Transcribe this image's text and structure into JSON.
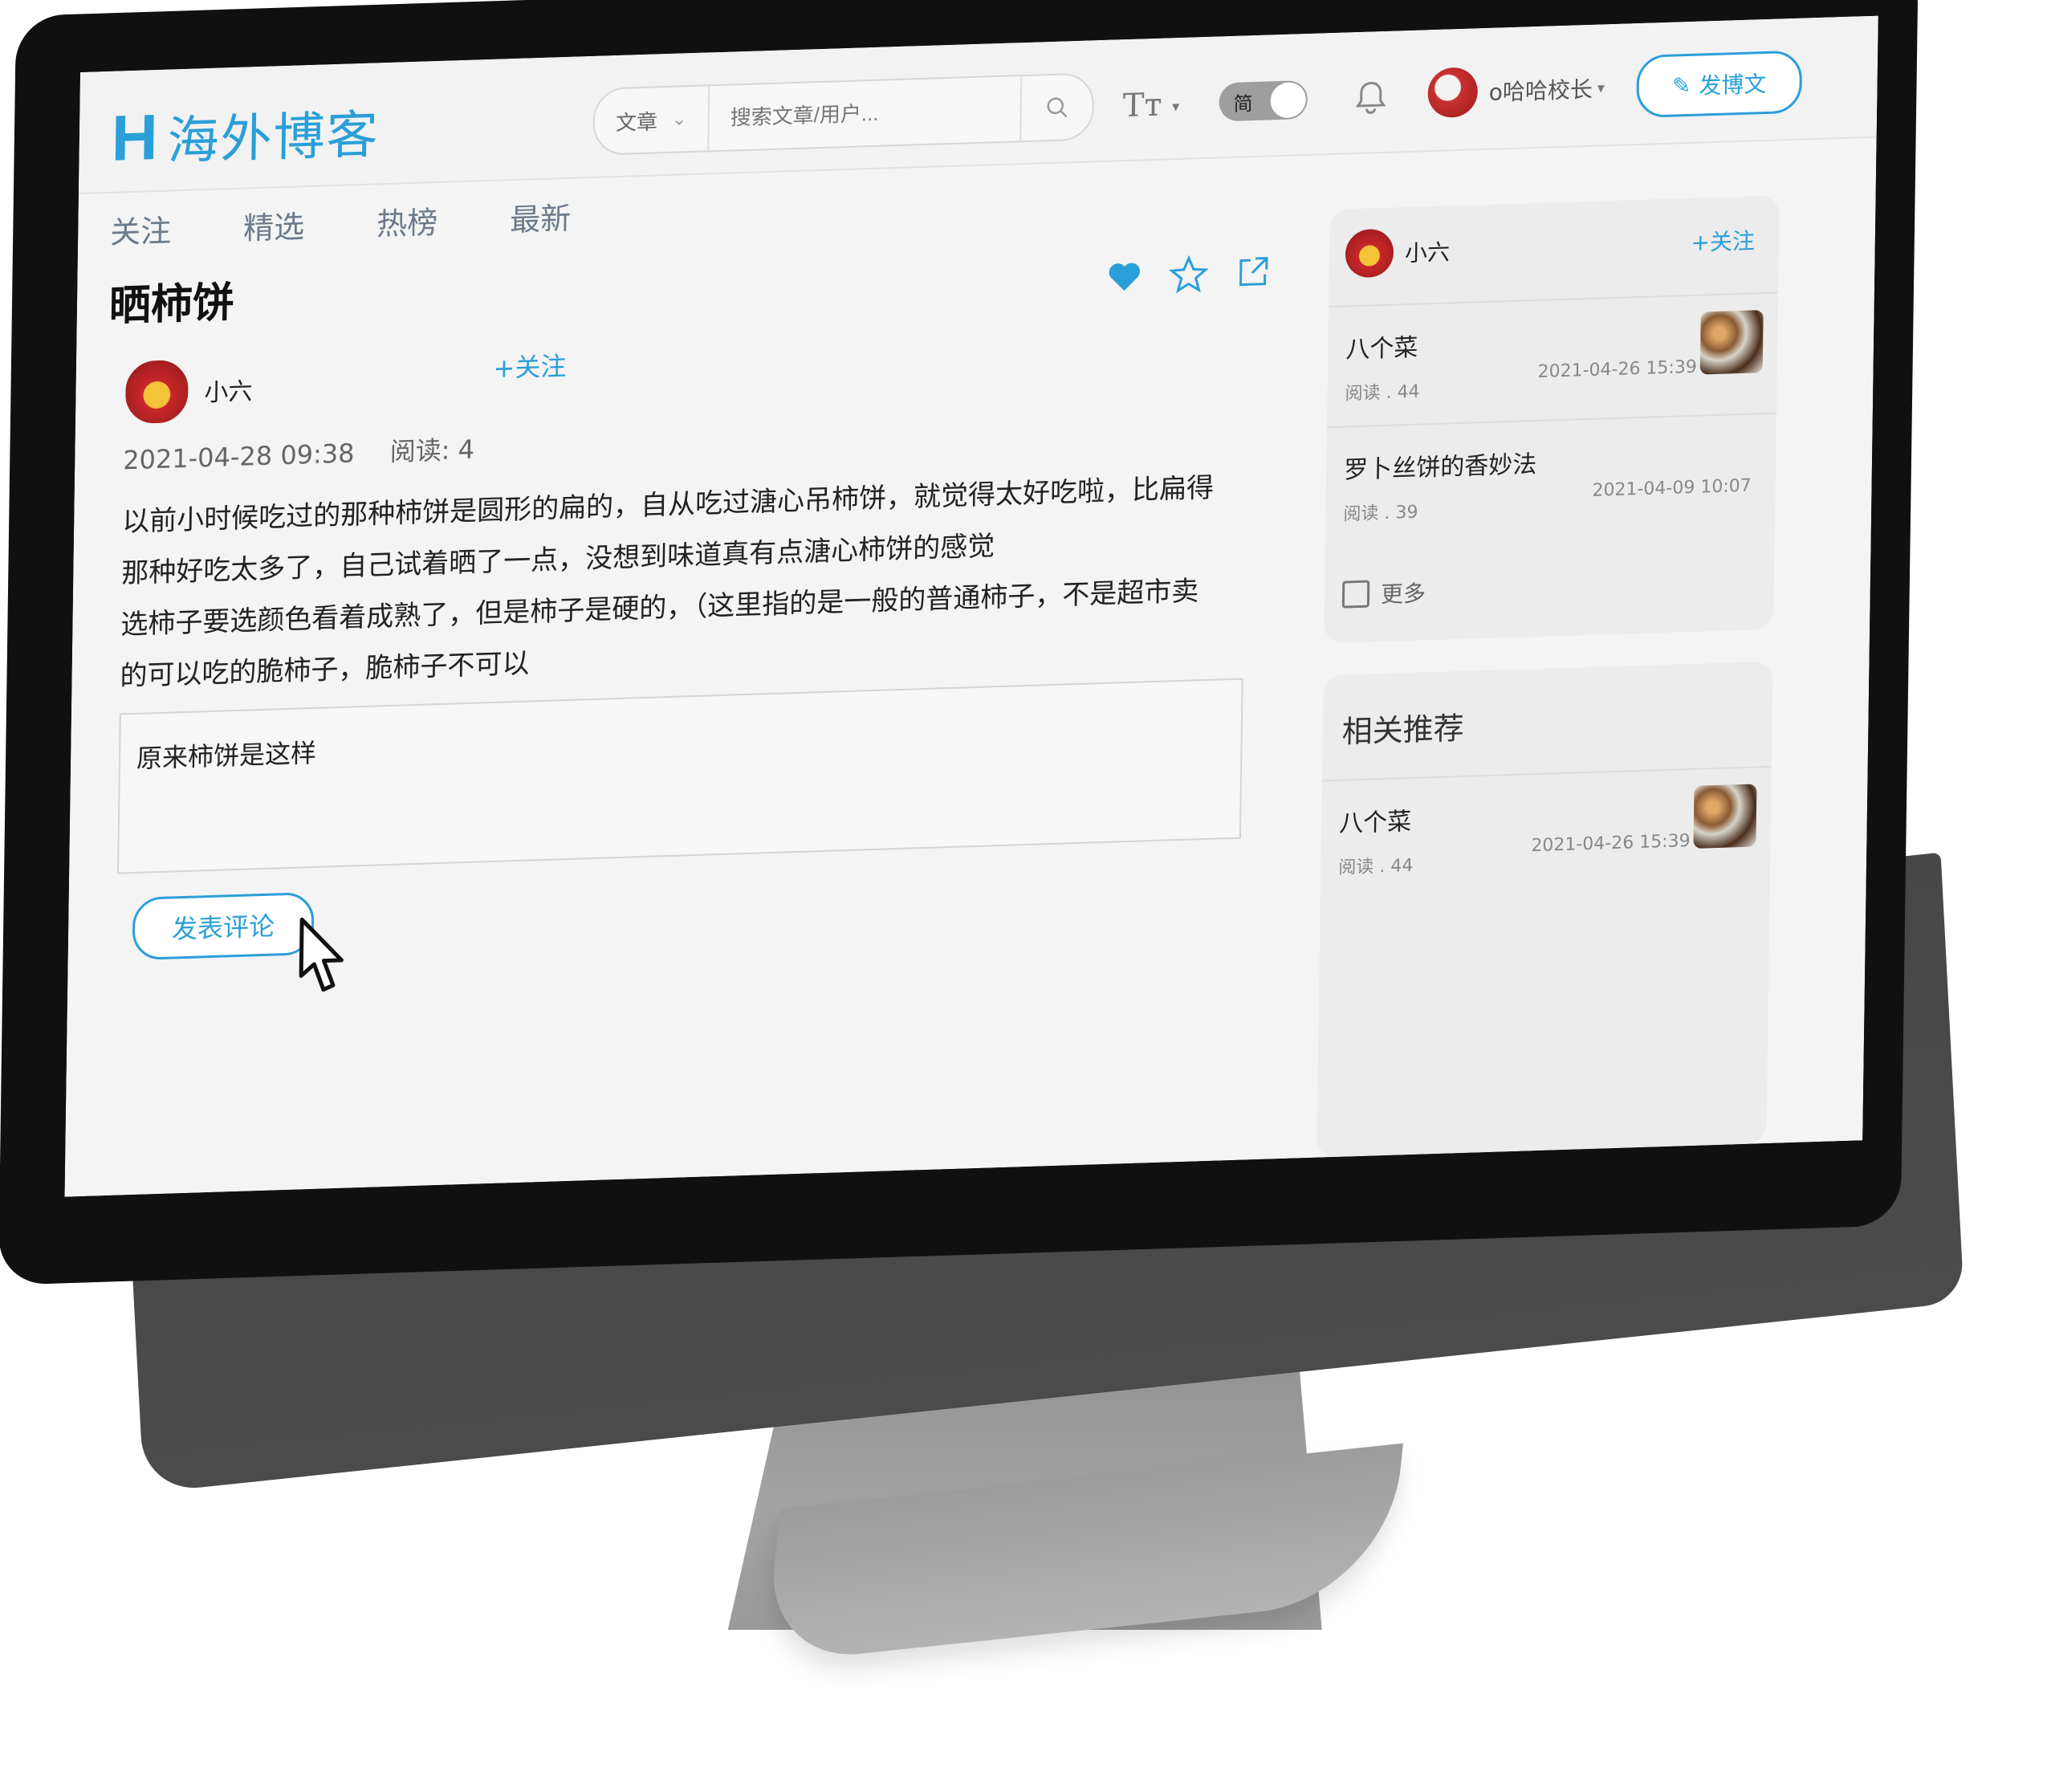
{
  "header": {
    "logo_mark": "H",
    "logo_text": "海外博客",
    "search": {
      "category": "文章",
      "placeholder": "搜索文章/用户..."
    },
    "font_size_label": "Tт",
    "lang_toggle_label": "简",
    "username": "o哈哈校长",
    "post_button_label": "发博文"
  },
  "nav": {
    "tabs": [
      "关注",
      "精选",
      "热榜",
      "最新"
    ]
  },
  "article": {
    "title": "晒柿饼",
    "author": "小六",
    "follow_label": "+关注",
    "datetime": "2021-04-28 09:38",
    "reads": "阅读: 4",
    "body_lines": [
      "以前小时候吃过的那种柿饼是圆形的扁的，自从吃过溏心吊柿饼，就觉得太好吃啦，比扁得",
      "那种好吃太多了，自己试着晒了一点，没想到味道真有点溏心柿饼的感觉",
      "选柿子要选颜色看着成熟了，但是柿子是硬的，（这里指的是一般的普通柿子，不是超市卖",
      "的可以吃的脆柿子，脆柿子不可以"
    ],
    "comment_value": "原来柿饼是这样",
    "submit_label": "发表评论"
  },
  "sidebar": {
    "author_card": {
      "author": "小六",
      "follow_label": "+关注",
      "posts": [
        {
          "title": "八个菜",
          "reads": "阅读 . 44",
          "date": "2021-04-26 15:39"
        },
        {
          "title": "罗卜丝饼的香妙法",
          "reads": "阅读 . 39",
          "date": "2021-04-09 10:07"
        }
      ],
      "more_label": "更多"
    },
    "related": {
      "title": "相关推荐",
      "posts": [
        {
          "title": "八个菜",
          "reads": "阅读 . 44",
          "date": "2021-04-26 15:39"
        }
      ]
    }
  },
  "colors": {
    "accent": "#2a9fd8",
    "bezel": "#101010",
    "chin": "#474747",
    "stand": "#9e9e9e"
  }
}
